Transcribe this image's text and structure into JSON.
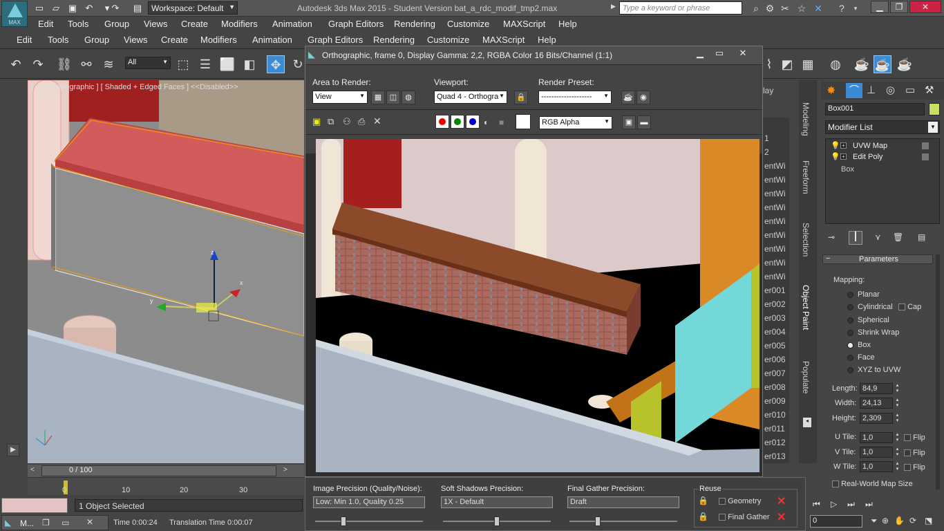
{
  "app": {
    "title": "Autodesk 3ds Max  2015   - Student Version     bat_a_rdc_modif_tmp2.max",
    "logo_text": "MAX",
    "workspace": "Workspace: Default",
    "search_placeholder": "Type a keyword or phrase"
  },
  "menu_outer": [
    "Edit",
    "Tools",
    "Group",
    "Views",
    "Create",
    "Modifiers",
    "Animation",
    "Graph Editors",
    "Rendering",
    "Customize",
    "MAXScript",
    "Help"
  ],
  "menu_inner": [
    "Edit",
    "Tools",
    "Group",
    "Views",
    "Create",
    "Modifiers",
    "Animation",
    "Graph Editors",
    "Rendering",
    "Customize",
    "MAXScript",
    "Help"
  ],
  "toolbar": {
    "selection_filter": "All"
  },
  "viewport": {
    "label": "[ + ] [ Orthographic ] [ Shaded + Edged Faces ]   <<Disabled>>",
    "frame_counter": "0 / 100",
    "timeline_ticks": [
      "0",
      "10",
      "20",
      "30"
    ]
  },
  "status": {
    "selection": "1 Object Selected",
    "time": "Time  0:00:24",
    "translation_time": "Translation Time  0:00:07",
    "taskbar_label": "M..."
  },
  "render_window": {
    "title": "Orthographic, frame 0, Display Gamma: 2,2, RGBA Color 16 Bits/Channel (1:1)",
    "area_label": "Area to Render:",
    "area_value": "View",
    "viewport_label": "Viewport:",
    "viewport_value": "Quad 4 - Orthogra",
    "preset_label": "Render Preset:",
    "preset_value": "--------------------",
    "channel_value": "RGB Alpha",
    "image_precision_label": "Image Precision (Quality/Noise):",
    "image_precision_value": "Low: Min 1.0, Quality 0.25",
    "soft_shadows_label": "Soft Shadows Precision:",
    "soft_shadows_value": "1X - Default",
    "final_gather_label": "Final Gather Precision:",
    "final_gather_value": "Draft",
    "reuse_label": "Reuse",
    "reuse_geometry": "Geometry",
    "reuse_final_gather": "Final Gather",
    "slider_levels": {
      "image_precision": 0.25,
      "soft_shadows": 0.5,
      "final_gather": 0.25
    }
  },
  "scene_list": [
    "lay",
    "",
    "1",
    "2",
    "entWi",
    "entWi",
    "entWi",
    "entWi",
    "entWi",
    "entWi",
    "entWi",
    "entWi",
    "entWi",
    "er001",
    "er002",
    "er003",
    "er004",
    "er005",
    "er006",
    "er007",
    "er008",
    "er009",
    "er010",
    "er011",
    "er012",
    "er013"
  ],
  "side_tabs": [
    "Modeling",
    "Freeform",
    "Selection",
    "Object Paint",
    "Populate"
  ],
  "command_panel": {
    "object_name": "Box001",
    "modifier_list_label": "Modifier List",
    "stack": [
      "UVW Map",
      "Edit Poly",
      "Box"
    ],
    "rollout_title": "Parameters",
    "mapping_label": "Mapping:",
    "mapping_options": [
      "Planar",
      "Cylindrical",
      "Spherical",
      "Shrink Wrap",
      "Box",
      "Face",
      "XYZ to UVW"
    ],
    "mapping_selected": "Box",
    "cap_label": "Cap",
    "length_label": "Length:",
    "length_value": "84,9",
    "width_label": "Width:",
    "width_value": "24,13",
    "height_label": "Height:",
    "height_value": "2,309",
    "utile_label": "U Tile:",
    "utile_value": "1,0",
    "vtile_label": "V Tile:",
    "vtile_value": "1,0",
    "wtile_label": "W Tile:",
    "wtile_value": "1,0",
    "flip_label": "Flip",
    "realworld_label": "Real-World Map Size"
  },
  "bottom_right": {
    "frame_field": "0"
  },
  "colors": {
    "accent": "#3a8bd4",
    "object_color": "#c8e060",
    "selection_red": "#e03030"
  }
}
